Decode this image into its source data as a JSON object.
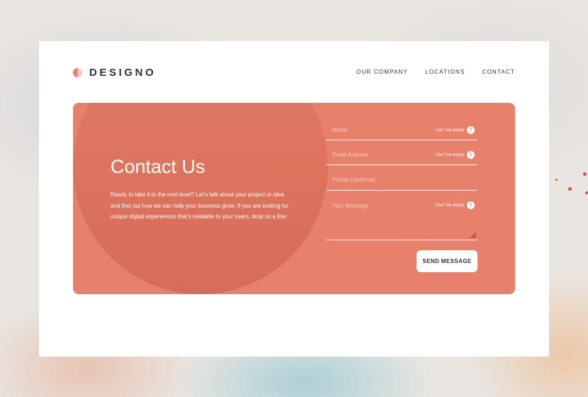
{
  "brand": {
    "name": "DESIGNO",
    "accent": "#e7816b",
    "dark": "#333136"
  },
  "nav": {
    "items": [
      "OUR COMPANY",
      "LOCATIONS",
      "CONTACT"
    ]
  },
  "contact": {
    "title": "Contact Us",
    "description": "Ready to take it to the next level? Let’s talk about your project or idea and find out how we can help your business grow. If you are looking for unique digital experiences that’s relatable to your users, drop us a line."
  },
  "form": {
    "fields": [
      {
        "placeholder": "Name",
        "error": "Can’t be empty"
      },
      {
        "placeholder": "Email Address",
        "error": "Can’t be empty"
      },
      {
        "placeholder": "Phone (Optional)",
        "error": ""
      },
      {
        "placeholder": "Your Message",
        "error": "Can’t be empty"
      }
    ],
    "error_icon": "exclamation-icon",
    "submit_label": "SEND MESSAGE"
  }
}
